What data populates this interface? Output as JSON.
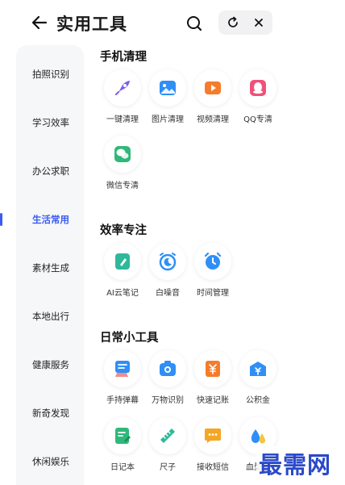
{
  "header": {
    "title": "实用工具",
    "back_icon": "arrow-left-icon",
    "search_icon": "search-icon",
    "refresh_icon": "refresh-icon",
    "close_icon": "close-icon"
  },
  "sidebar": {
    "active_color": "#3a5cf0",
    "items": [
      {
        "label": "拍照识别",
        "active": false
      },
      {
        "label": "学习效率",
        "active": false
      },
      {
        "label": "办公求职",
        "active": false
      },
      {
        "label": "生活常用",
        "active": true
      },
      {
        "label": "素材生成",
        "active": false
      },
      {
        "label": "本地出行",
        "active": false
      },
      {
        "label": "健康服务",
        "active": false
      },
      {
        "label": "新奇发现",
        "active": false
      },
      {
        "label": "休闲娱乐",
        "active": false
      }
    ]
  },
  "sections": [
    {
      "title": "手机清理",
      "tools": [
        {
          "label": "一键清理",
          "icon": "rocket-icon",
          "color": "#7b5cf0"
        },
        {
          "label": "图片清理",
          "icon": "image-icon",
          "color": "#2f8ff7"
        },
        {
          "label": "视频清理",
          "icon": "video-icon",
          "color": "#f57c2b"
        },
        {
          "label": "QQ专清",
          "icon": "qq-icon",
          "color": "#f0517a"
        },
        {
          "label": "微信专清",
          "icon": "wechat-icon",
          "color": "#2fb87a"
        }
      ]
    },
    {
      "title": "效率专注",
      "tools": [
        {
          "label": "AI云笔记",
          "icon": "note-icon",
          "color": "#2fb89a"
        },
        {
          "label": "白噪音",
          "icon": "moon-alarm-icon",
          "color": "#2f8ff7"
        },
        {
          "label": "时间管理",
          "icon": "alarm-clock-icon",
          "color": "#2f8ff7"
        }
      ]
    },
    {
      "title": "日常小工具",
      "tools": [
        {
          "label": "手持弹幕",
          "icon": "danmaku-icon",
          "color": "#2f8ff7"
        },
        {
          "label": "万物识别",
          "icon": "camera-icon",
          "color": "#2f8ff7"
        },
        {
          "label": "快速记账",
          "icon": "ledger-icon",
          "color": "#f57c2b"
        },
        {
          "label": "公积金",
          "icon": "fund-box-icon",
          "color": "#2f8ff7"
        },
        {
          "label": "日记本",
          "icon": "diary-icon",
          "color": "#2fb87a"
        },
        {
          "label": "尺子",
          "icon": "ruler-icon",
          "color": "#2fb89a"
        },
        {
          "label": "接收短信",
          "icon": "sms-icon",
          "color": "#f5a623"
        },
        {
          "label": "血型遗",
          "icon": "blood-drop-icon",
          "color": "#2f8ff7"
        }
      ]
    }
  ],
  "watermark": "最需网"
}
